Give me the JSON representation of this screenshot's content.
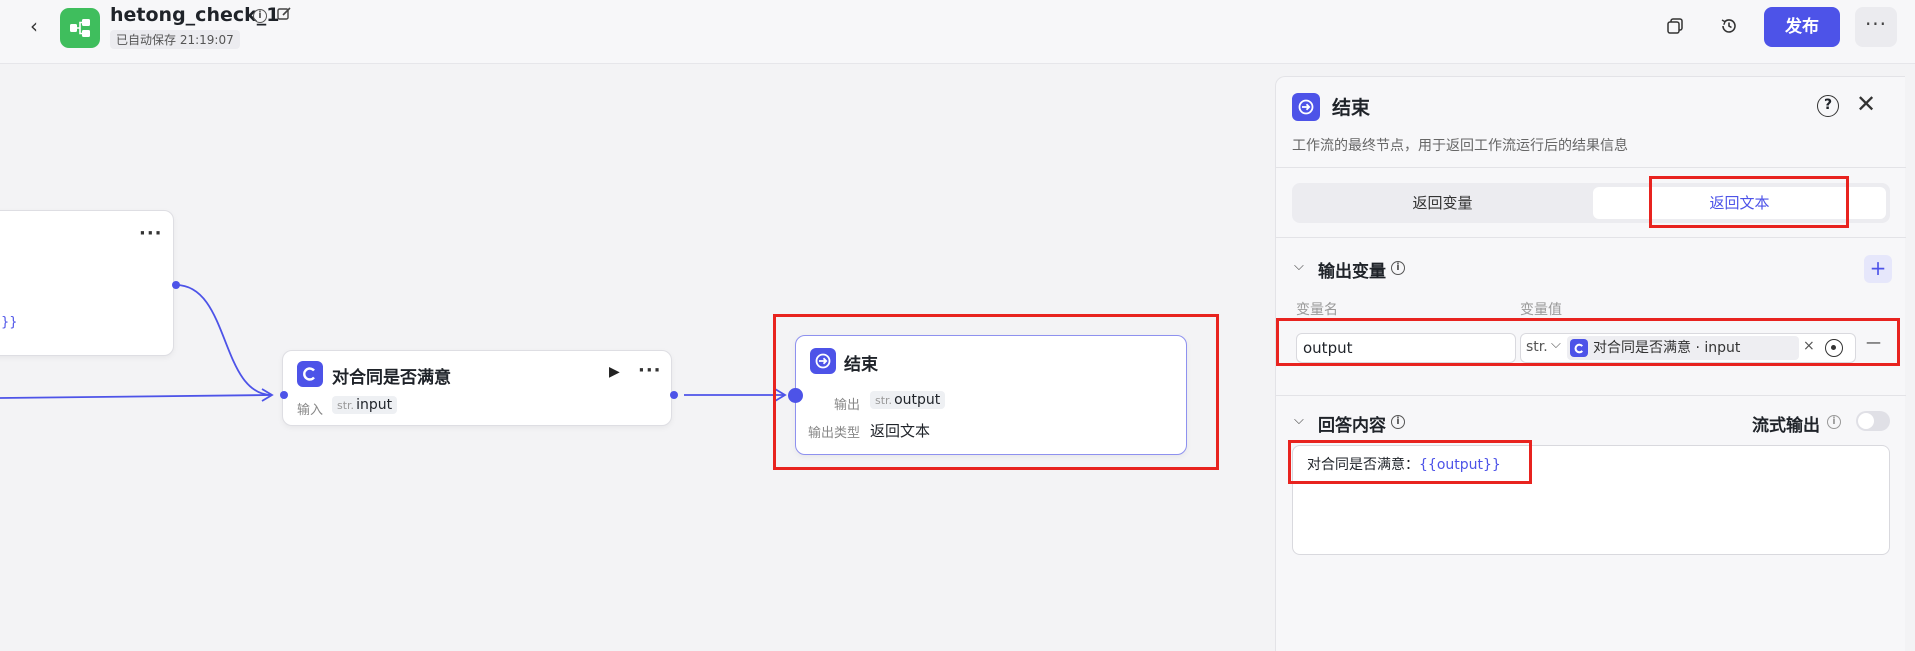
{
  "header": {
    "back_icon": "chevron-left-icon",
    "title": "hetong_check_1",
    "autosave": "已自动保存 21:19:07",
    "publish_label": "发布",
    "more_label": "···"
  },
  "canvas": {
    "partial_node": {
      "more_label": "···",
      "fragment_text": "}}"
    },
    "condition_node": {
      "title": "对合同是否满意",
      "run_label": "▶",
      "more_label": "···",
      "input_label": "输入",
      "input_type": "str.",
      "input_value": "input"
    },
    "end_node": {
      "title": "结束",
      "output_label": "输出",
      "output_type": "str.",
      "output_value": "output",
      "output_type_label": "输出类型",
      "output_type_value": "返回文本"
    }
  },
  "panel": {
    "title": "结束",
    "description": "工作流的最终节点，用于返回工作流运行后的结果信息",
    "tabs": [
      "返回变量",
      "返回文本"
    ],
    "active_tab": "返回文本",
    "output_section": {
      "title": "输出变量",
      "col_name": "变量名",
      "col_value": "变量值",
      "row": {
        "name": "output",
        "type": "str.",
        "ref": "对合同是否满意 · input",
        "clear": "×",
        "remove": "—"
      }
    },
    "answer_section": {
      "title": "回答内容",
      "streaming_label": "流式输出",
      "streaming_on": false,
      "text_prefix": "对合同是否满意：",
      "text_var": "{{output}}"
    }
  },
  "colors": {
    "accent": "#4d53e8",
    "highlight": "#e8231f",
    "logo": "#3fbe5d"
  }
}
